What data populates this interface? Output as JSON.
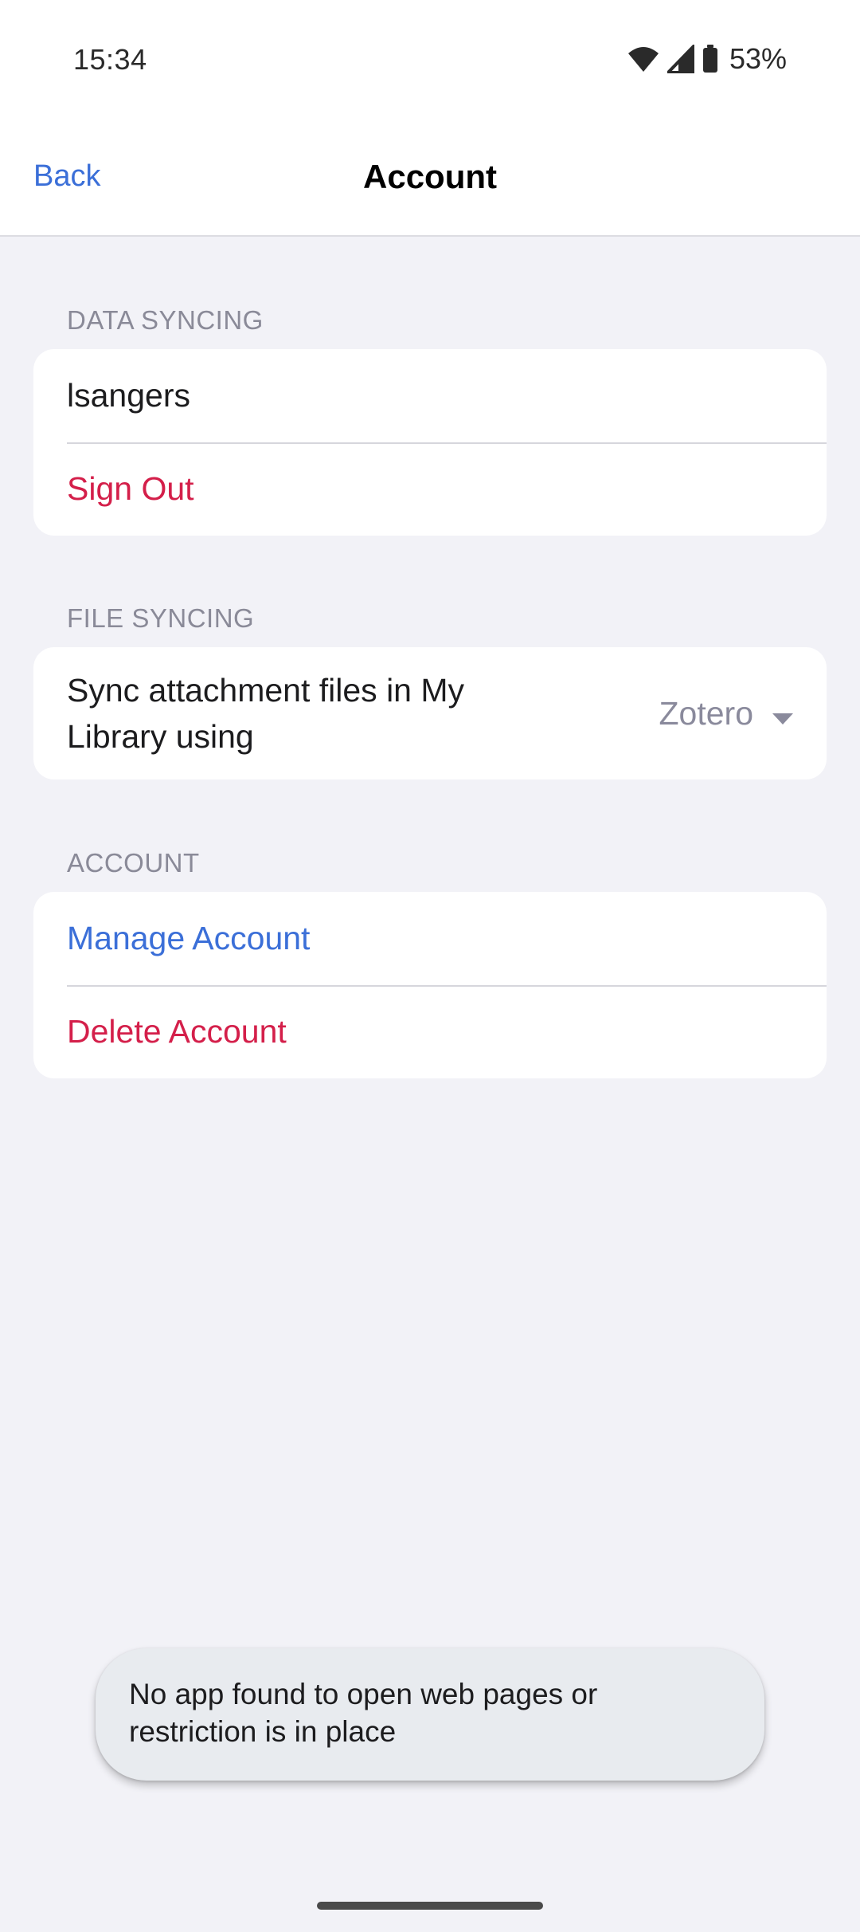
{
  "status_bar": {
    "time": "15:34",
    "battery_percent": "53%",
    "icons": [
      "wifi-icon",
      "cell-signal-icon",
      "battery-icon"
    ]
  },
  "nav": {
    "back_label": "Back",
    "title": "Account"
  },
  "data_syncing": {
    "header": "DATA SYNCING",
    "username": "lsangers",
    "sign_out_label": "Sign Out"
  },
  "file_syncing": {
    "header": "FILE SYNCING",
    "label": "Sync attachment files in My Library using",
    "selected_option": "Zotero"
  },
  "account": {
    "header": "ACCOUNT",
    "manage_label": "Manage Account",
    "delete_label": "Delete Account"
  },
  "toast": {
    "message": "No app found to open web pages or restriction is in place"
  },
  "colors": {
    "accent_blue": "#3b6fd8",
    "destructive_red": "#d41f4a",
    "background": "#f2f2f7",
    "secondary_text": "#8a8a98"
  }
}
